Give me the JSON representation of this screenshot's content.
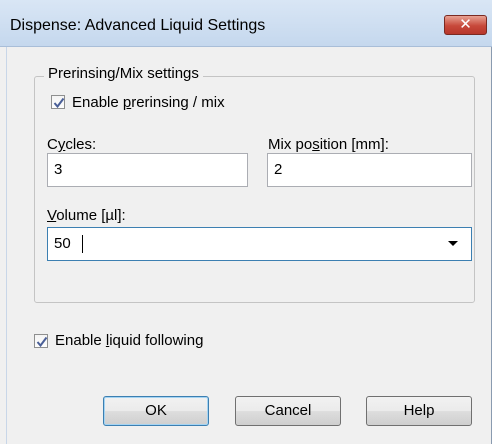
{
  "window": {
    "title": "Dispense: Advanced Liquid Settings",
    "close_glyph": "✕"
  },
  "group": {
    "legend": "Prerinsing/Mix settings",
    "enable_prerinsing": {
      "checked": true,
      "label_pre": "Enable ",
      "label_accel": "p",
      "label_post": "rerinsing / mix"
    },
    "cycles": {
      "label_pre": "C",
      "label_accel": "y",
      "label_post": "cles:",
      "value": "3"
    },
    "mix_position": {
      "label_pre": "Mix po",
      "label_accel": "s",
      "label_post": "ition [mm]:",
      "value": "2"
    },
    "volume": {
      "label_pre": "",
      "label_accel": "V",
      "label_post": "olume [µl]:",
      "value": "50"
    }
  },
  "enable_liquid_following": {
    "checked": true,
    "label_pre": "Enable ",
    "label_accel": "l",
    "label_post": "iquid following"
  },
  "buttons": {
    "ok": "OK",
    "cancel": "Cancel",
    "help": "Help"
  }
}
